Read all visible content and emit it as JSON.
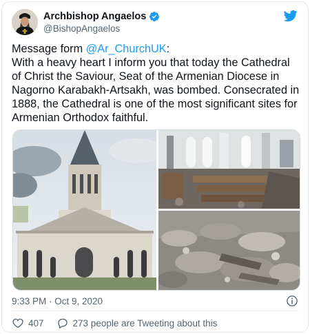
{
  "tweet": {
    "author_name": "Archbishop Angaelos",
    "handle": "@BishopAngaelos",
    "text_line1_prefix": "Message form ",
    "mention": "@Ar_ChurchUK",
    "text_line1_suffix": ":",
    "text_body": "With a heavy heart I inform you that today the Cathedral of Christ the Saviour, Seat of the Armenian Diocese in Nagorno Karabakh-Artsakh, was bombed. Consecrated in 1888, the Cathedral is one of the most significant sites for Armenian Orthodox faithful.",
    "timestamp": "9:33 PM · Oct 9, 2020",
    "likes": "407",
    "tweeting_about": "273 people are Tweeting about this"
  },
  "icons": {
    "verified": "verified-badge-icon",
    "brand": "twitter-bird-icon",
    "info": "info-icon",
    "like": "heart-icon",
    "reply": "speech-bubble-icon"
  },
  "colors": {
    "accent": "#1d9bf0",
    "text": "#0f1419",
    "secondary": "#536471"
  }
}
